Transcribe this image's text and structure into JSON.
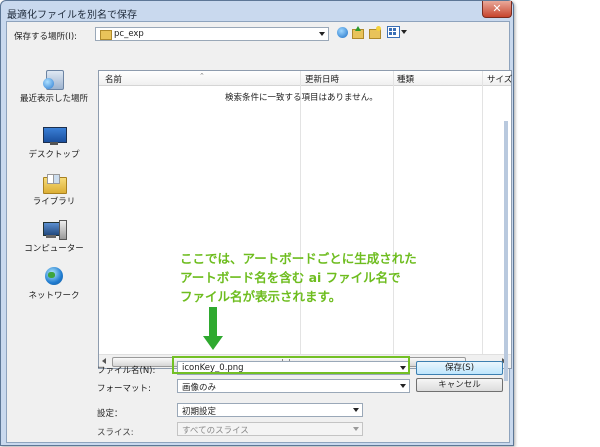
{
  "window": {
    "title": "最適化ファイルを別名で保存",
    "close_glyph": "✕"
  },
  "toolbar": {
    "save_in_label": "保存する場所(I):",
    "location": "pc_exp"
  },
  "places": [
    {
      "label": "最近表示した場所",
      "icon": "recent-places-icon"
    },
    {
      "label": "デスクトップ",
      "icon": "desktop-icon"
    },
    {
      "label": "ライブラリ",
      "icon": "library-icon"
    },
    {
      "label": "コンピューター",
      "icon": "computer-icon"
    },
    {
      "label": "ネットワーク",
      "icon": "network-icon"
    }
  ],
  "list": {
    "columns": [
      "名前",
      "更新日時",
      "種類",
      "サイズ"
    ],
    "empty_message": "検索条件に一致する項目はありません。"
  },
  "form": {
    "filename_label": "ファイル名(N):",
    "filename_value": "iconKey_0.png",
    "format_label": "フォーマット:",
    "format_value": "画像のみ",
    "save_button": "保存(S)",
    "cancel_button": "キャンセル",
    "settings_label": "設定：",
    "settings_value": "初期設定",
    "slices_label": "スライス:",
    "slices_value": "すべてのスライス"
  },
  "annotation": {
    "lines": [
      "ここでは、アートボードごとに生成された",
      "アートボード名を含む ai ファイル名で",
      "ファイル名が表示されます。"
    ]
  }
}
